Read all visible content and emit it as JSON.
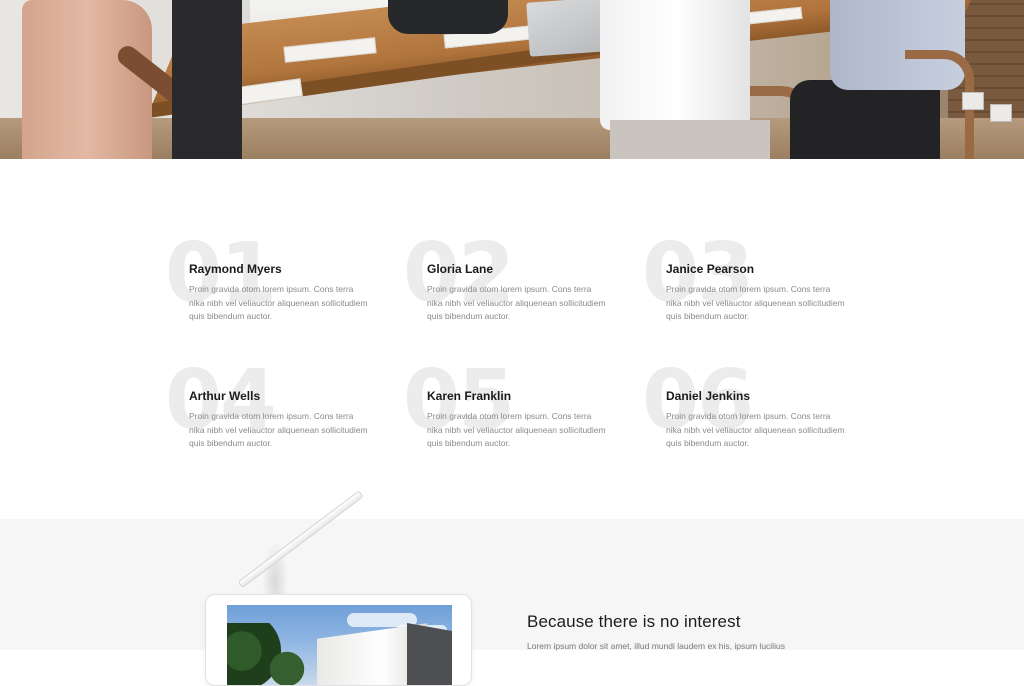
{
  "team": {
    "members": [
      {
        "number": "01",
        "name": "Raymond Myers",
        "description": "Proin gravida otom lorem ipsum. Cons terra nika nibh vel veliauctor aliquenean sollicitudiem quis bibendum auctor."
      },
      {
        "number": "02",
        "name": "Gloria Lane",
        "description": "Proin gravida otom lorem ipsum. Cons terra nika nibh vel veliauctor aliquenean sollicitudiem quis bibendum auctor."
      },
      {
        "number": "03",
        "name": "Janice Pearson",
        "description": "Proin gravida otom lorem ipsum. Cons terra nika nibh vel veliauctor aliquenean sollicitudiem quis bibendum auctor."
      },
      {
        "number": "04",
        "name": "Arthur Wells",
        "description": "Proin gravida otom lorem ipsum. Cons terra nika nibh vel veliauctor aliquenean sollicitudiem quis bibendum auctor."
      },
      {
        "number": "05",
        "name": "Karen Franklin",
        "description": "Proin gravida otom lorem ipsum. Cons terra nika nibh vel veliauctor aliquenean sollicitudiem quis bibendum auctor."
      },
      {
        "number": "06",
        "name": "Daniel Jenkins",
        "description": "Proin gravida otom lorem ipsum. Cons terra nika nibh vel veliauctor aliquenean sollicitudiem quis bibendum auctor."
      }
    ]
  },
  "feature": {
    "title": "Because there is no interest",
    "body": "Lorem ipsum dolor sit amet, illud mundi laudem ex his, ipsum lucilius"
  }
}
